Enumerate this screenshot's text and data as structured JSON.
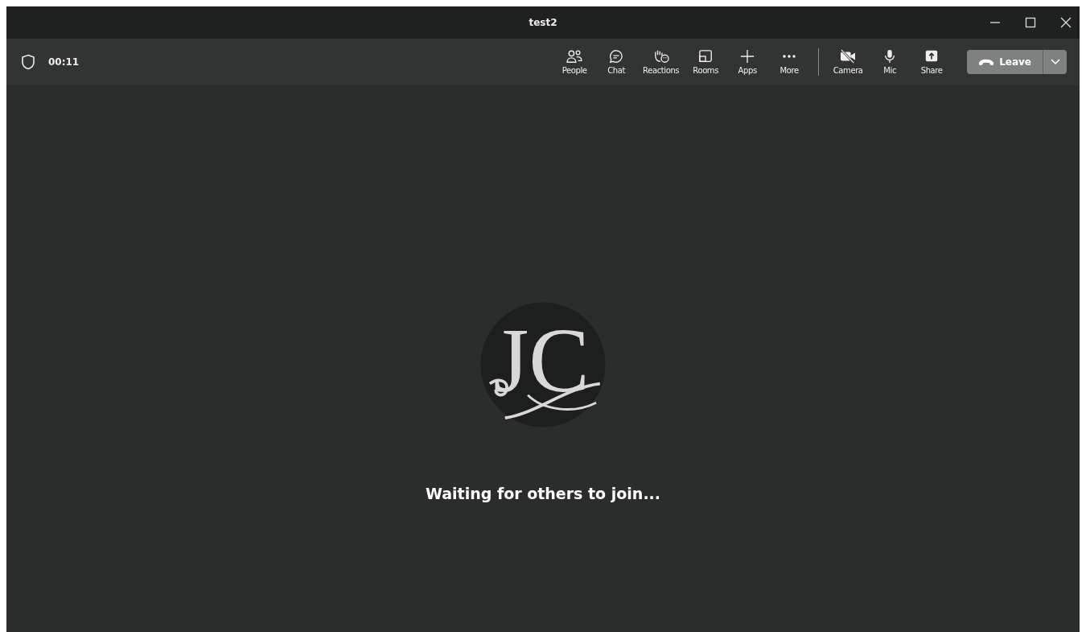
{
  "window": {
    "title": "test2"
  },
  "meeting": {
    "timer": "00:11"
  },
  "toolbar": {
    "actions": [
      {
        "label": "People"
      },
      {
        "label": "Chat"
      },
      {
        "label": "Reactions"
      },
      {
        "label": "Rooms"
      },
      {
        "label": "Apps"
      },
      {
        "label": "More"
      }
    ],
    "devices": [
      {
        "label": "Camera",
        "on": false
      },
      {
        "label": "Mic",
        "on": true
      }
    ],
    "share": {
      "label": "Share"
    },
    "leave": {
      "label": "Leave"
    }
  },
  "stage": {
    "avatar": {
      "initials": "JC"
    },
    "message": "Waiting for others to join..."
  }
}
